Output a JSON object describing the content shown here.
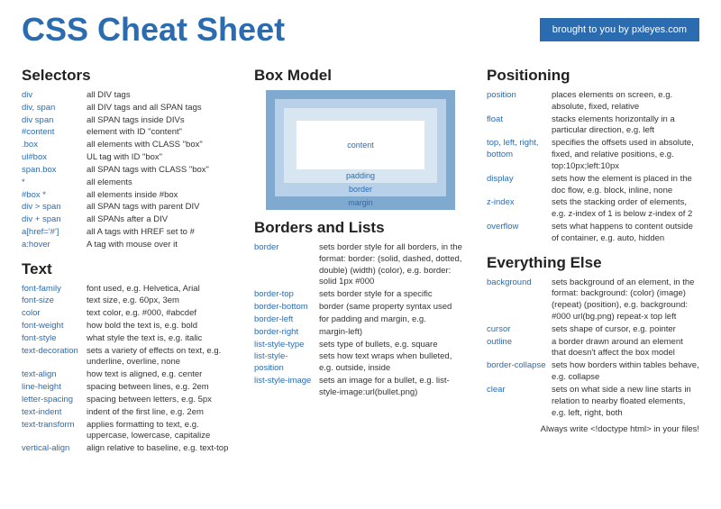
{
  "header": {
    "title": "CSS Cheat Sheet",
    "credit": "brought to you by pxleyes.com"
  },
  "boxmodel": {
    "content": "content",
    "padding": "padding",
    "border": "border",
    "margin": "margin"
  },
  "sections": {
    "selectors": {
      "title": "Selectors",
      "rows": [
        {
          "term": "div",
          "desc": "all DIV tags"
        },
        {
          "term": "div, span",
          "desc": "all DIV tags and all SPAN tags"
        },
        {
          "term": "div span",
          "desc": "all SPAN tags inside DIVs"
        },
        {
          "term": "#content",
          "desc": "element with ID \"content\""
        },
        {
          "term": ".box",
          "desc": "all elements with CLASS \"box\""
        },
        {
          "term": "ul#box",
          "desc": "UL tag with ID \"box\""
        },
        {
          "term": "span.box",
          "desc": "all SPAN tags with CLASS \"box\""
        },
        {
          "term": "*",
          "desc": "all elements"
        },
        {
          "term": "#box *",
          "desc": "all elements inside #box"
        },
        {
          "term": "div > span",
          "desc": "all SPAN tags with parent DIV"
        },
        {
          "term": "div + span",
          "desc": "all SPANs after a DIV"
        },
        {
          "term": "a[href='#']",
          "desc": "all A tags with HREF set to #"
        },
        {
          "term": "a:hover",
          "desc": "A tag with mouse over it"
        }
      ]
    },
    "text": {
      "title": "Text",
      "rows": [
        {
          "term": "font-family",
          "desc": "font used, e.g. Helvetica, Arial"
        },
        {
          "term": "font-size",
          "desc": "text size, e.g. 60px, 3em"
        },
        {
          "term": "color",
          "desc": "text color, e.g. #000, #abcdef"
        },
        {
          "term": "font-weight",
          "desc": "how bold the text is, e.g. bold"
        },
        {
          "term": "font-style",
          "desc": "what style the text is, e.g. italic"
        },
        {
          "term": "text-decoration",
          "desc": "sets a variety of effects on text, e.g. underline, overline, none"
        },
        {
          "term": "text-align",
          "desc": "how text is aligned, e.g. center"
        },
        {
          "term": "line-height",
          "desc": "spacing between lines, e.g. 2em"
        },
        {
          "term": "letter-spacing",
          "desc": "spacing between letters, e.g. 5px"
        },
        {
          "term": "text-indent",
          "desc": "indent of the first line, e.g. 2em"
        },
        {
          "term": "text-transform",
          "desc": "applies formatting to text, e.g. uppercase, lowercase, capitalize"
        },
        {
          "term": "vertical-align",
          "desc": "align relative to baseline, e.g. text-top"
        }
      ]
    },
    "boxmodel": {
      "title": "Box Model"
    },
    "borders": {
      "title": "Borders and Lists",
      "rows": [
        {
          "term": "border",
          "desc": "sets border style for all borders, in the format: border: (solid, dashed, dotted, double) (width) (color), e.g. border: solid 1px #000"
        },
        {
          "term": "border-top",
          "desc": "sets border style for a specific"
        },
        {
          "term": "border-bottom",
          "desc": "border (same property syntax used"
        },
        {
          "term": "border-left",
          "desc": "for padding and margin, e.g."
        },
        {
          "term": "border-right",
          "desc": "margin-left)"
        },
        {
          "term": "list-style-type",
          "desc": "sets type of bullets, e.g. square"
        },
        {
          "term": "list-style-position",
          "desc": "sets how text wraps when bulleted, e.g. outside, inside"
        },
        {
          "term": "list-style-image",
          "desc": "sets an image for a bullet, e.g. list-style-image:url(bullet.png)"
        }
      ]
    },
    "positioning": {
      "title": "Positioning",
      "rows": [
        {
          "term": "position",
          "desc": "places elements on screen, e.g. absolute, fixed, relative"
        },
        {
          "term": "float",
          "desc": "stacks elements horizontally in a particular direction, e.g. left"
        },
        {
          "term": "top, left, right, bottom",
          "desc": "specifies the offsets used in absolute, fixed, and relative positions, e.g. top:10px;left:10px"
        },
        {
          "term": "display",
          "desc": "sets how the element is placed in the doc flow, e.g. block, inline, none"
        },
        {
          "term": "z-index",
          "desc": "sets the stacking order of elements, e.g. z-index of 1 is below z-index of 2"
        },
        {
          "term": "overflow",
          "desc": "sets what happens to content outside of container, e.g. auto, hidden"
        }
      ]
    },
    "everything": {
      "title": "Everything Else",
      "rows": [
        {
          "term": "background",
          "desc": "sets background of an element, in the format: background: (color) (image) (repeat) (position), e.g. background: #000 url(bg.png) repeat-x top left"
        },
        {
          "term": "cursor",
          "desc": "sets shape of cursor, e.g. pointer"
        },
        {
          "term": "outline",
          "desc": "a border drawn around an element that doesn't affect the box model"
        },
        {
          "term": "border-collapse",
          "desc": "sets how borders within tables behave, e.g. collapse"
        },
        {
          "term": "clear",
          "desc": "sets on what side a new line starts in relation to nearby floated elements, e.g. left, right, both"
        }
      ]
    }
  },
  "footer_note": "Always write <!doctype html> in your files!"
}
